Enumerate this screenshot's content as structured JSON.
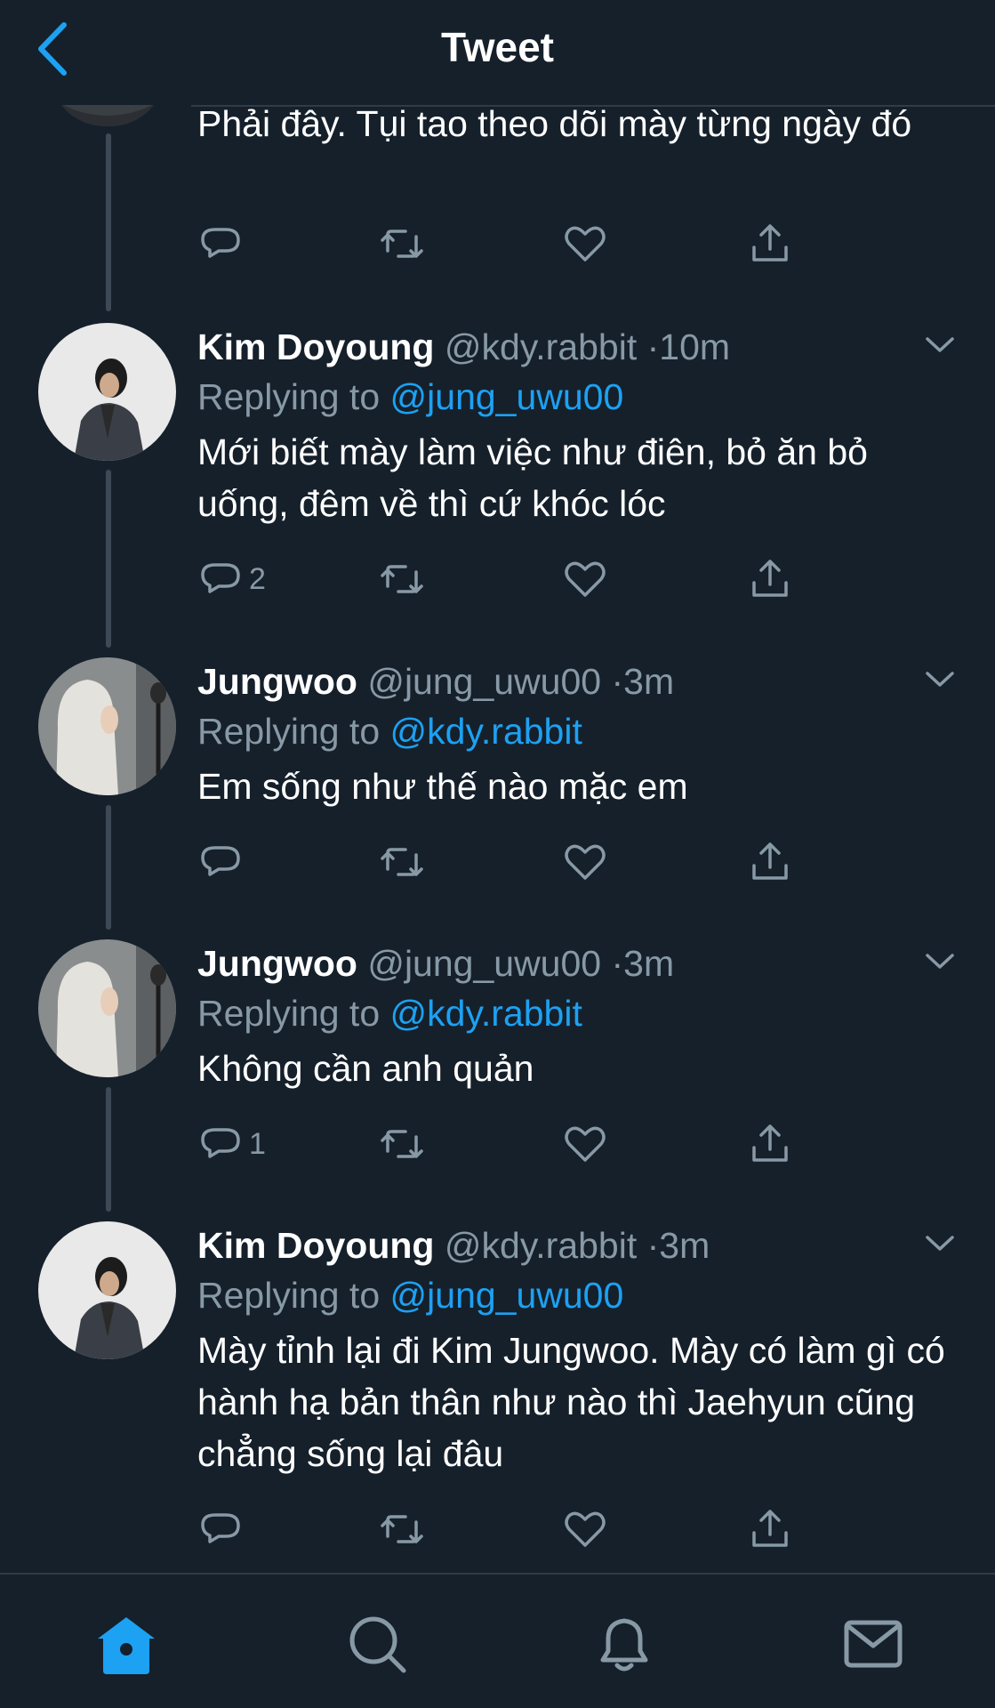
{
  "header": {
    "title": "Tweet"
  },
  "first_tweet": {
    "text": "Phải đây. Tụi tao theo dõi mày từng ngày đó"
  },
  "tweets": [
    {
      "name": "Kim Doyoung",
      "handle": "@kdy.rabbit",
      "time": "10m",
      "replying_label": "Replying to",
      "replying_to": "@jung_uwu00",
      "text": "Mới biết mày làm việc như điên, bỏ ăn bỏ uống, đêm về thì cứ khóc lóc",
      "reply_count": "2"
    },
    {
      "name": "Jungwoo",
      "handle": "@jung_uwu00",
      "time": "3m",
      "replying_label": "Replying to",
      "replying_to": "@kdy.rabbit",
      "text": "Em sống như thế nào mặc em",
      "reply_count": ""
    },
    {
      "name": "Jungwoo",
      "handle": "@jung_uwu00",
      "time": "3m",
      "replying_label": "Replying to",
      "replying_to": "@kdy.rabbit",
      "text": "Không cần anh quản",
      "reply_count": "1"
    },
    {
      "name": "Kim Doyoung",
      "handle": "@kdy.rabbit",
      "time": "3m",
      "replying_label": "Replying to",
      "replying_to": "@jung_uwu00",
      "text": "Mày tỉnh lại đi Kim Jungwoo. Mày có làm gì có hành hạ bản thân như nào thì Jaehyun cũng chẳng sống lại đâu",
      "reply_count": ""
    }
  ],
  "separator": "·",
  "icons": {
    "back": "chevron-left-icon",
    "reply": "reply-icon",
    "retweet": "retweet-icon",
    "like": "heart-icon",
    "share": "share-icon",
    "caret": "chevron-down-icon",
    "home": "home-icon",
    "search": "search-icon",
    "notifications": "bell-icon",
    "messages": "mail-icon"
  },
  "colors": {
    "background": "#15202b",
    "accent": "#1da1f2",
    "secondary_text": "#8899a6",
    "text": "#ffffff"
  }
}
